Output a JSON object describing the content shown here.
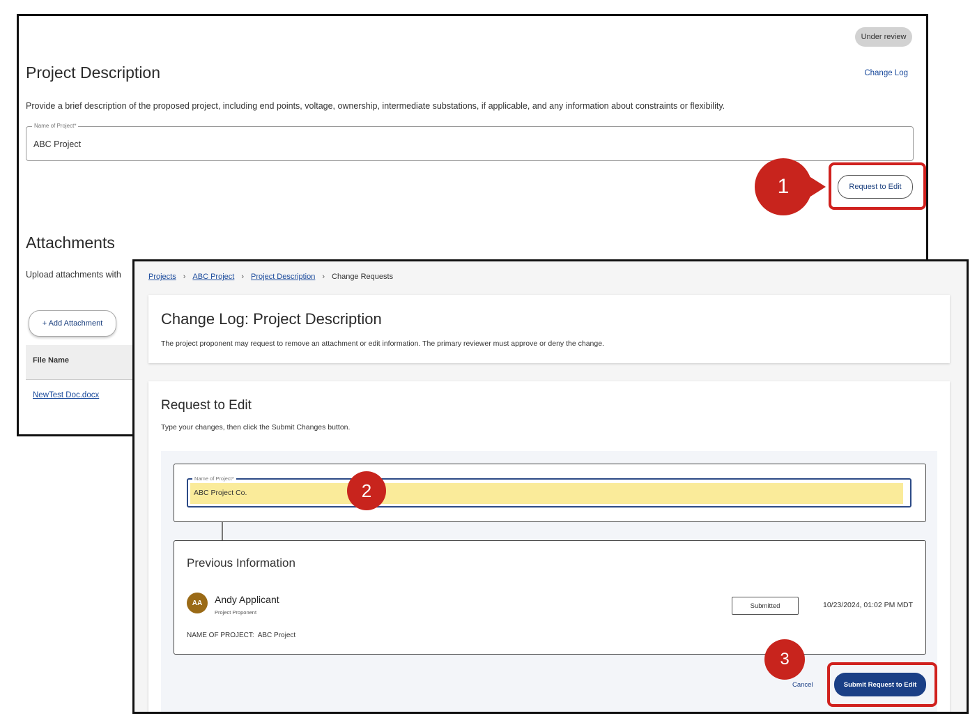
{
  "back": {
    "status": "Under review",
    "title": "Project Description",
    "change_log": "Change Log",
    "description": "Provide a brief description of the proposed project, including end points, voltage, ownership, intermediate substations, if applicable, and any information about constraints or flexibility.",
    "name_label": "Name of Project*",
    "name_value": "ABC Project",
    "request_edit": "Request to Edit",
    "callout": "1",
    "attachments_title": "Attachments",
    "attachments_desc": "Upload attachments with",
    "add_attachment": "+ Add Attachment",
    "file_name_header": "File Name",
    "file_link": "NewTest Doc.docx"
  },
  "front": {
    "breadcrumb": [
      "Projects",
      "ABC Project",
      "Project Description",
      "Change Requests"
    ],
    "breadcrumb_sep": "›",
    "changelog_title": "Change Log: Project Description",
    "changelog_desc": "The project proponent may request to remove an attachment or edit information. The primary reviewer must approve or deny the change.",
    "request_title": "Request to Edit",
    "request_desc": "Type your changes, then click the Submit Changes button.",
    "field_label": "Name of Project*",
    "field_value": "ABC Project Co.",
    "callout2": "2",
    "previous_title": "Previous Information",
    "avatar_initials": "AA",
    "user_name": "Andy Applicant",
    "user_role": "Project Proponent",
    "status_badge": "Submitted",
    "timestamp": "10/23/2024, 01:02 PM MDT",
    "prev_field_label": "NAME OF PROJECT:",
    "prev_field_value": "ABC Project",
    "cancel": "Cancel",
    "submit": "Submit Request to Edit",
    "callout3": "3"
  },
  "colors": {
    "callout_red": "#c8241d",
    "primary_blue": "#1a3f86",
    "highlight_yellow": "#faeb9a",
    "avatar_brown": "#9a6a16"
  }
}
